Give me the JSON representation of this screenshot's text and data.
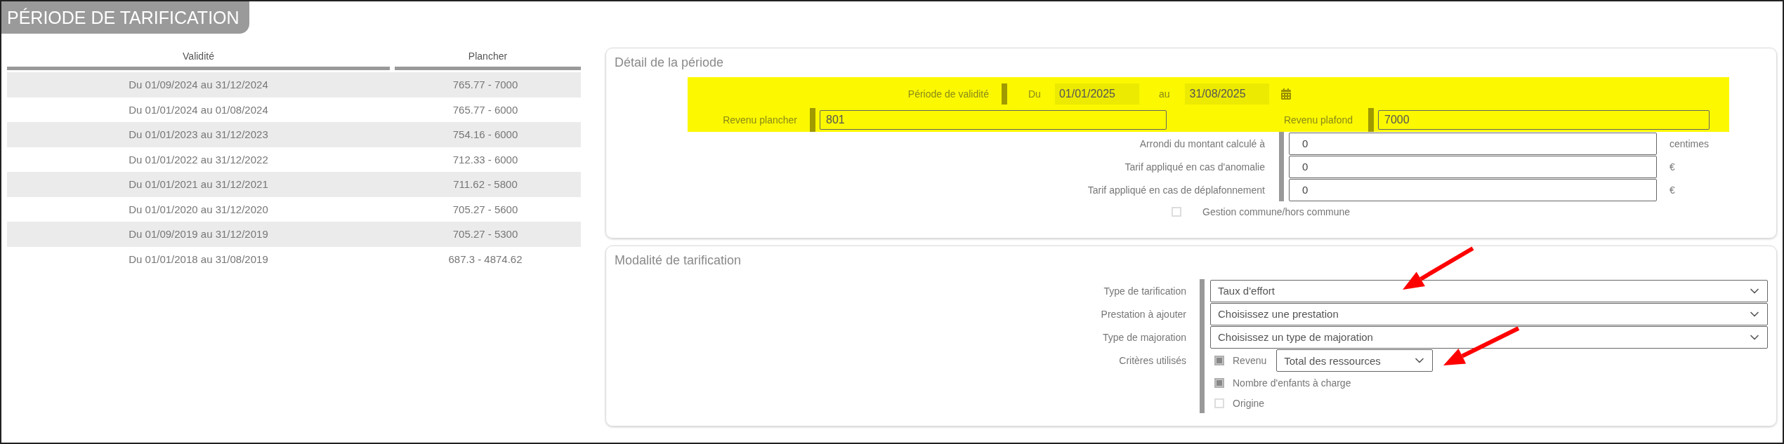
{
  "page_title": "PÉRIODE DE TARIFICATION",
  "periods_table": {
    "columns": [
      "Validité",
      "Plancher"
    ],
    "rows": [
      {
        "validity": "Du 01/09/2024 au 31/12/2024",
        "floor": "765.77 - 7000"
      },
      {
        "validity": "Du 01/01/2024 au 01/08/2024",
        "floor": "765.77 - 6000"
      },
      {
        "validity": "Du 01/01/2023 au 31/12/2023",
        "floor": "754.16 - 6000"
      },
      {
        "validity": "Du 01/01/2022 au 31/12/2022",
        "floor": "712.33 - 6000"
      },
      {
        "validity": "Du 01/01/2021 au 31/12/2021",
        "floor": "711.62 - 5800"
      },
      {
        "validity": "Du 01/01/2020 au 31/12/2020",
        "floor": "705.27 - 5600"
      },
      {
        "validity": "Du 01/09/2019 au 31/12/2019",
        "floor": "705.27 - 5300"
      },
      {
        "validity": "Du 01/01/2018 au 31/08/2019",
        "floor": "687.3 - 4874.62"
      }
    ]
  },
  "period_detail": {
    "title": "Détail de la période",
    "validity": {
      "label": "Période de validité",
      "from_label": "Du",
      "from": "01/01/2025",
      "to_label": "au",
      "to": "31/08/2025"
    },
    "floor_income": {
      "label": "Revenu plancher",
      "value": "801"
    },
    "ceiling_income": {
      "label": "Revenu plafond",
      "value": "7000"
    },
    "fields": [
      {
        "label": "Arrondi du montant calculé à",
        "value": "0",
        "unit": "centimes"
      },
      {
        "label": "Tarif appliqué en cas d'anomalie",
        "value": "0",
        "unit": "€"
      },
      {
        "label": "Tarif appliqué en cas de déplafonnement",
        "value": "0",
        "unit": "€"
      }
    ],
    "shared_management": {
      "label": "Gestion commune/hors commune",
      "checked": false
    }
  },
  "pricing_mode": {
    "title": "Modalité de tarification",
    "selects": [
      {
        "label": "Type de tarification",
        "value": "Taux d'effort"
      },
      {
        "label": "Prestation à ajouter",
        "value": "Choisissez une prestation"
      },
      {
        "label": "Type de majoration",
        "value": "Choisissez un type de majoration"
      }
    ],
    "criteria": {
      "label": "Critères utilisés",
      "items": [
        {
          "label": "Revenu",
          "checked": true,
          "select": "Total des ressources"
        },
        {
          "label": "Nombre d'enfants à charge",
          "checked": true
        },
        {
          "label": "Origine",
          "checked": false
        }
      ]
    }
  }
}
